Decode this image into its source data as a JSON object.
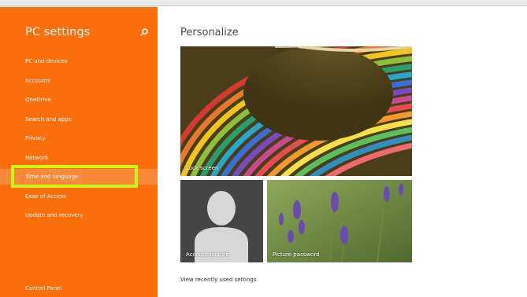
{
  "sidebar": {
    "title": "PC settings",
    "search_icon": "search-icon",
    "items": [
      {
        "label": "PC and devices"
      },
      {
        "label": "Accounts"
      },
      {
        "label": "OneDrive"
      },
      {
        "label": "Search and apps"
      },
      {
        "label": "Privacy"
      },
      {
        "label": "Network"
      },
      {
        "label": "Time and language"
      },
      {
        "label": "Ease of Access"
      },
      {
        "label": "Update and recovery"
      }
    ],
    "selected_item": "Time and language",
    "footer_link": "Control Panel"
  },
  "main": {
    "title": "Personalize",
    "tiles": {
      "lock_screen": "Lock screen",
      "account_picture": "Account picture",
      "picture_password": "Picture password"
    },
    "recent_link": "View recently used settings"
  },
  "colors": {
    "sidebar_bg": "#fa6f0b",
    "highlight_box": "#c9f60d",
    "selected_item_bg": "#f98a3a"
  }
}
